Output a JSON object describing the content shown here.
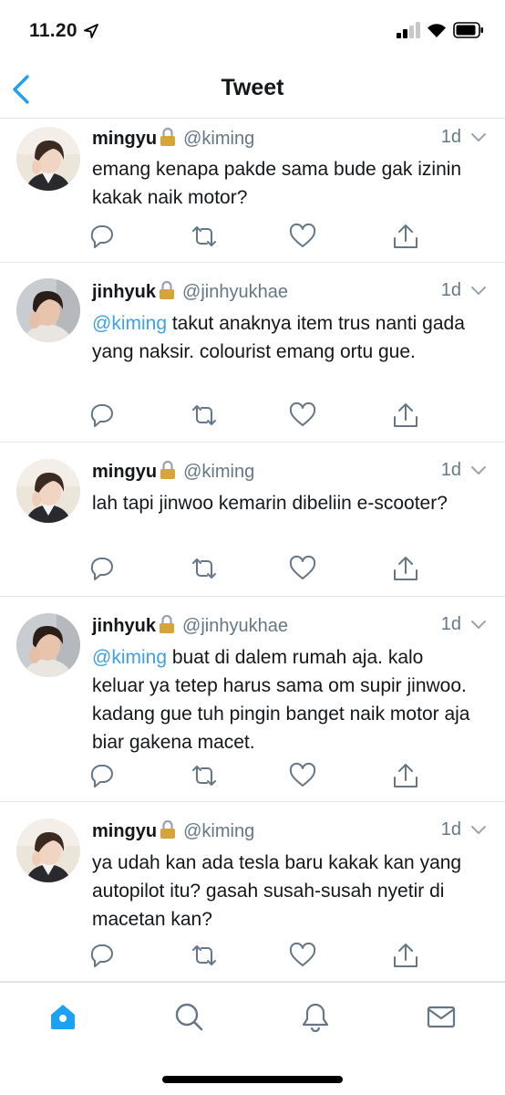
{
  "status_bar": {
    "time": "11.20"
  },
  "header": {
    "title": "Tweet"
  },
  "tweets": [
    {
      "display_name": "mingyu",
      "handle": "@kiming",
      "time": "1d",
      "mention": "",
      "text": "emang kenapa pakde sama bude gak izinin kakak naik motor?"
    },
    {
      "display_name": "jinhyuk",
      "handle": "@jinhyukhae",
      "time": "1d",
      "mention": "@kiming",
      "text": " takut anaknya item trus nanti gada yang naksir. colourist emang ortu gue."
    },
    {
      "display_name": "mingyu",
      "handle": "@kiming",
      "time": "1d",
      "mention": "",
      "text": "lah tapi jinwoo kemarin dibeliin e-scooter?"
    },
    {
      "display_name": "jinhyuk",
      "handle": "@jinhyukhae",
      "time": "1d",
      "mention": "@kiming",
      "text": " buat di dalem rumah aja. kalo keluar ya tetep harus sama om supir jinwoo. kadang gue tuh pingin banget naik motor aja biar gakena macet."
    },
    {
      "display_name": "mingyu",
      "handle": "@kiming",
      "time": "1d",
      "mention": "",
      "text": "ya udah kan ada tesla baru kakak kan yang autopilot itu? gasah susah-susah nyetir di macetan kan?"
    }
  ],
  "tab_bar": {
    "items": [
      {
        "icon": "home-icon",
        "active": true
      },
      {
        "icon": "search-icon",
        "active": false
      },
      {
        "icon": "notifications-icon",
        "active": false
      },
      {
        "icon": "messages-icon",
        "active": false
      }
    ]
  },
  "colors": {
    "accent": "#1da1f2",
    "mention": "#3ea0e6",
    "secondary_text": "#657786",
    "icon": "#657786",
    "divider": "#e3e7ea"
  }
}
